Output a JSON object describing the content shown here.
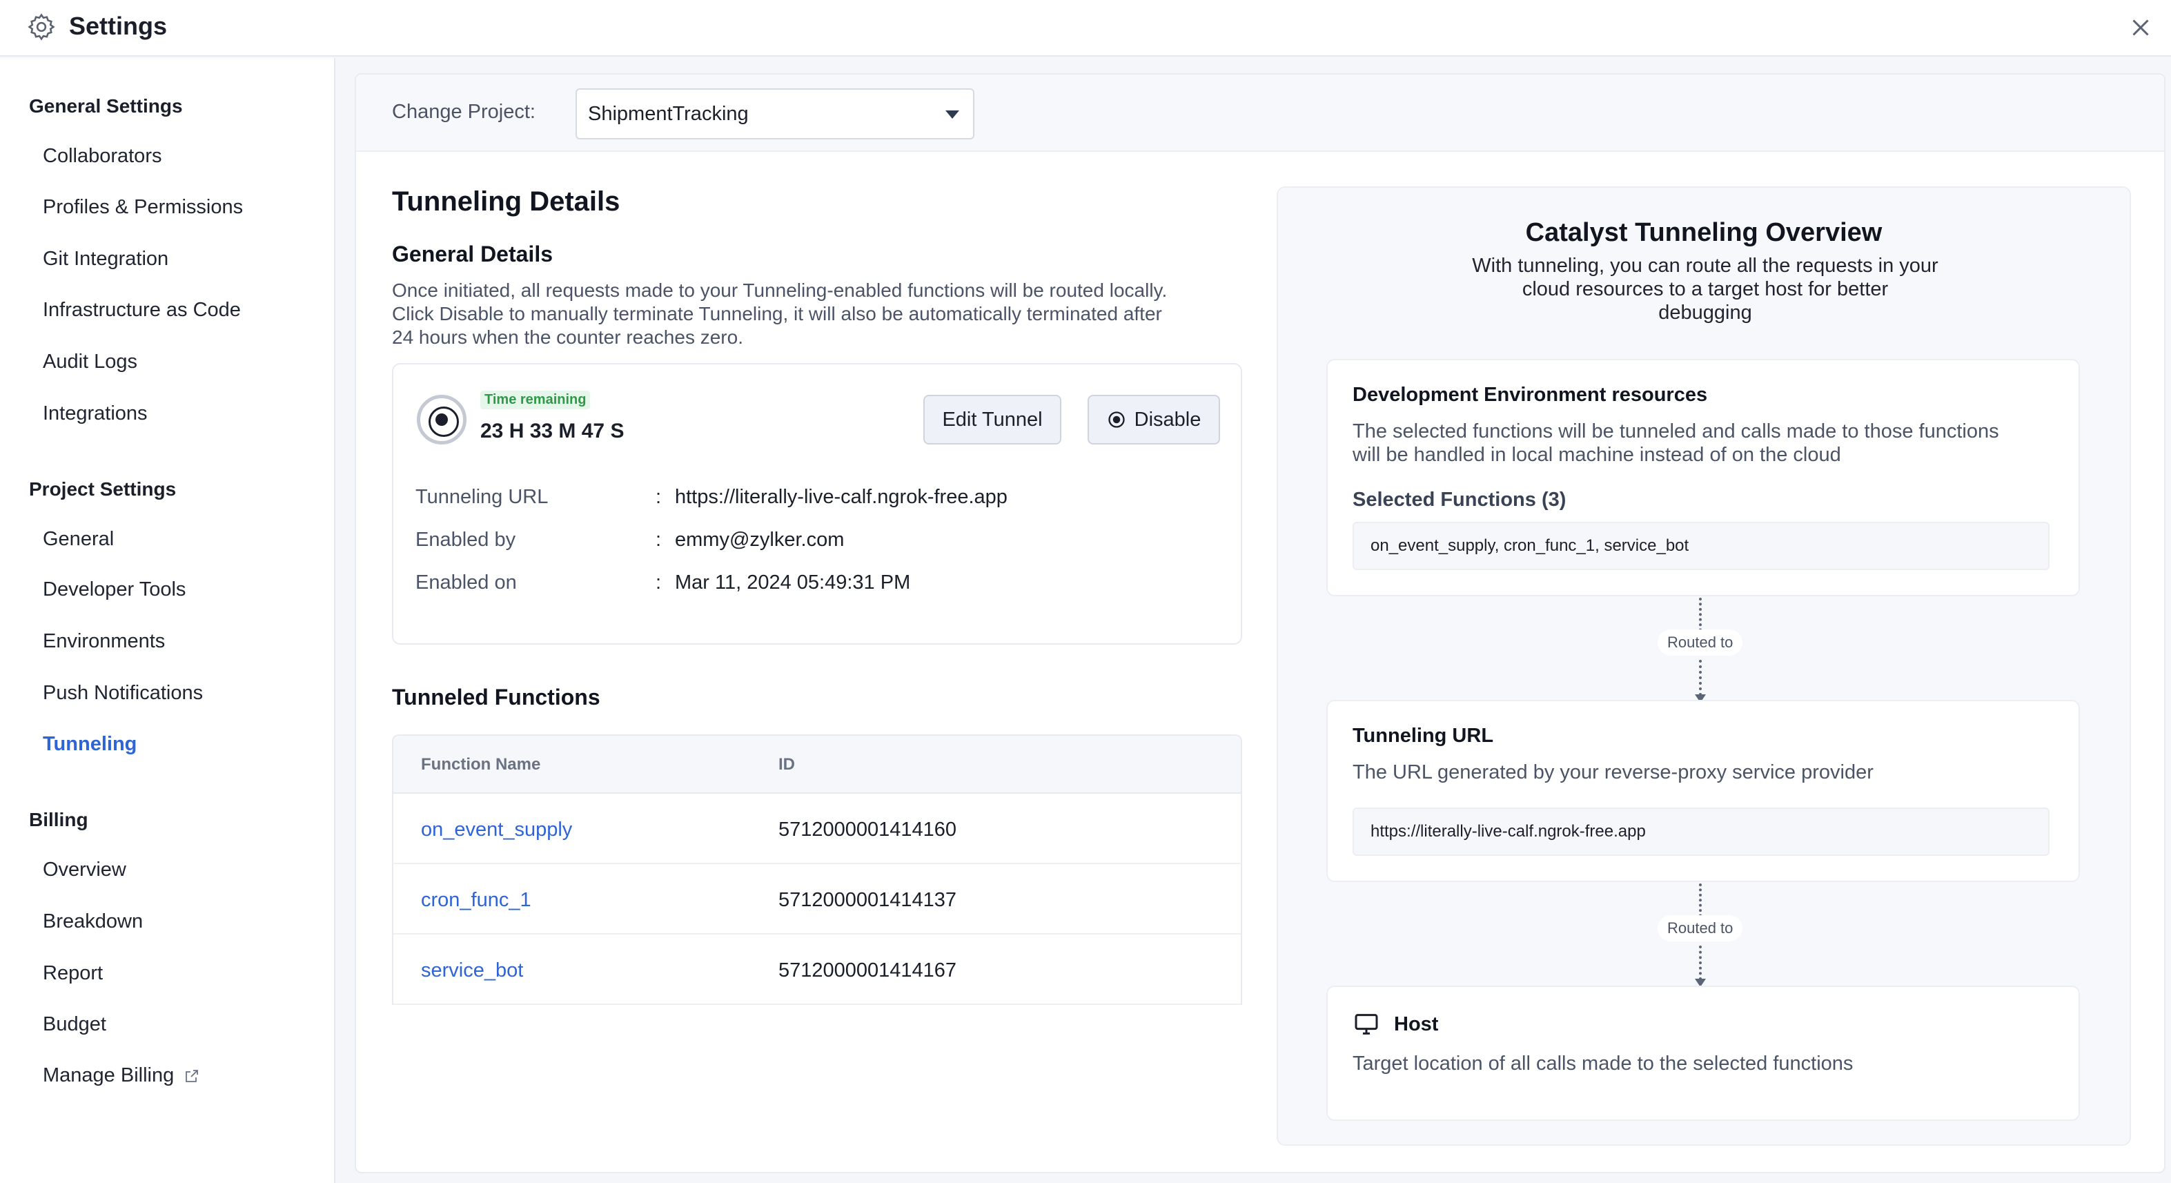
{
  "header": {
    "title": "Settings"
  },
  "sidebar": {
    "general_title": "General Settings",
    "general_items": [
      "Collaborators",
      "Profiles & Permissions",
      "Git Integration",
      "Infrastructure as Code",
      "Audit Logs",
      "Integrations"
    ],
    "project_title": "Project Settings",
    "project_items": [
      "General",
      "Developer Tools",
      "Environments",
      "Push Notifications",
      "Tunneling"
    ],
    "billing_title": "Billing",
    "billing_items": [
      "Overview",
      "Breakdown",
      "Report",
      "Budget",
      "Manage Billing"
    ],
    "active_item": "Tunneling"
  },
  "project": {
    "label": "Change Project:",
    "selected": "ShipmentTracking"
  },
  "details": {
    "title": "Tunneling Details",
    "general_title": "General Details",
    "general_desc_1": "Once initiated, all requests made to your Tunneling-enabled functions will be routed locally.",
    "general_desc_2": "Click Disable to manually terminate Tunneling, it will also be automatically terminated after",
    "general_desc_3": "24 hours when the counter reaches zero.",
    "time_label": "Time remaining",
    "time_value": "23 H 33 M 47 S",
    "edit_label": "Edit Tunnel",
    "disable_label": "Disable",
    "rows": [
      {
        "label": "Tunneling URL",
        "value": "https://literally-live-calf.ngrok-free.app"
      },
      {
        "label": "Enabled by",
        "value": "emmy@zylker.com"
      },
      {
        "label": "Enabled on",
        "value": "Mar 11, 2024 05:49:31 PM"
      }
    ],
    "colon": ":"
  },
  "functions": {
    "title": "Tunneled Functions",
    "col_name": "Function Name",
    "col_id": "ID",
    "rows": [
      {
        "name": "on_event_supply",
        "id": "5712000001414160"
      },
      {
        "name": "cron_func_1",
        "id": "5712000001414137"
      },
      {
        "name": "service_bot",
        "id": "5712000001414167"
      }
    ]
  },
  "overview": {
    "title": "Catalyst Tunneling Overview",
    "sub_1": "With tunneling, you can route all the requests in your",
    "sub_2": "cloud resources to a target host for better",
    "sub_3": "debugging",
    "dev_title": "Development Environment resources",
    "dev_desc_1": "The selected functions will be tunneled and calls made to those functions",
    "dev_desc_2": "will be handled in local machine instead of on the cloud",
    "selected_label": "Selected Functions",
    "selected_count": "(3)",
    "selected_value": "on_event_supply, cron_func_1, service_bot",
    "routed_label": "Routed to",
    "url_title": "Tunneling URL",
    "url_desc": "The URL generated by your reverse-proxy service provider",
    "url_value": "https://literally-live-calf.ngrok-free.app",
    "host_title": "Host",
    "host_desc": "Target location of all calls made to the selected functions"
  },
  "colors": {
    "accent": "#2f64d6",
    "success": "#2e9a48"
  }
}
